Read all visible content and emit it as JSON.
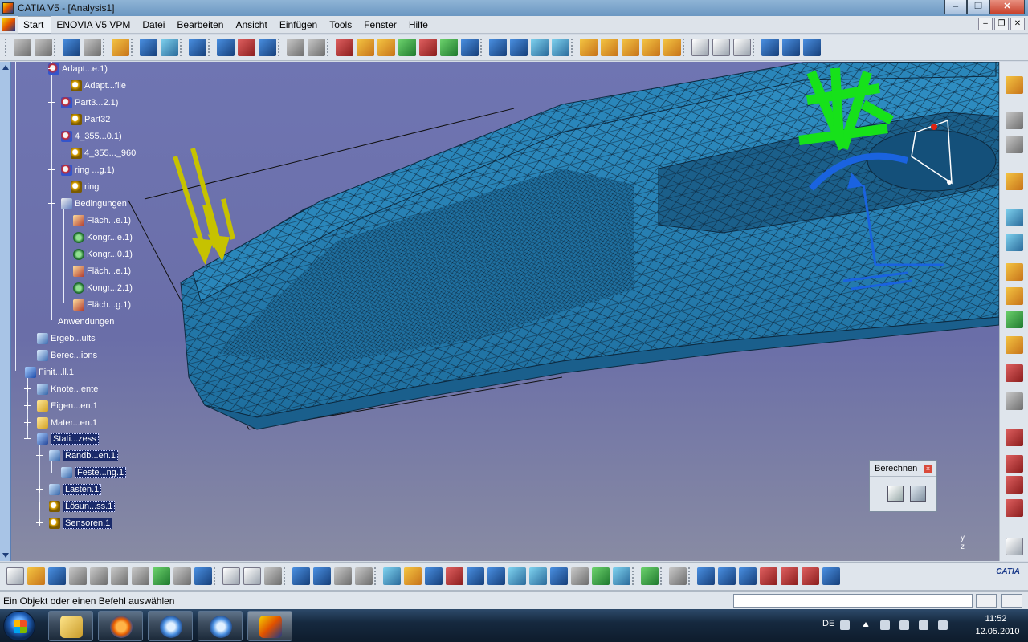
{
  "window": {
    "title": "CATIA V5 - [Analysis1]"
  },
  "menu": {
    "items": [
      {
        "label": "Start"
      },
      {
        "label": "ENOVIA V5 VPM"
      },
      {
        "label": "Datei"
      },
      {
        "label": "Bearbeiten"
      },
      {
        "label": "Ansicht"
      },
      {
        "label": "Einfügen"
      },
      {
        "label": "Tools"
      },
      {
        "label": "Fenster"
      },
      {
        "label": "Hilfe"
      }
    ]
  },
  "tree": {
    "nodes": [
      {
        "label": "Adapt...e.1)",
        "icon": "product-icon"
      },
      {
        "label": "Adapt...file",
        "icon": "part-icon"
      },
      {
        "label": "Part3...2.1)",
        "icon": "product-icon"
      },
      {
        "label": "Part32",
        "icon": "part-icon"
      },
      {
        "label": "4_355...0.1)",
        "icon": "product-icon"
      },
      {
        "label": "4_355..._960",
        "icon": "part-icon"
      },
      {
        "label": "ring ...g.1)",
        "icon": "product-icon"
      },
      {
        "label": "ring",
        "icon": "part-icon"
      },
      {
        "label": "Bedingungen",
        "icon": "constraints-icon"
      },
      {
        "label": "Fläch...e.1)",
        "icon": "surface-contact-icon"
      },
      {
        "label": "Kongr...e.1)",
        "icon": "coincidence-icon"
      },
      {
        "label": "Kongr...0.1)",
        "icon": "coincidence-icon"
      },
      {
        "label": "Fläch...e.1)",
        "icon": "surface-contact-icon"
      },
      {
        "label": "Kongr...2.1)",
        "icon": "coincidence-icon"
      },
      {
        "label": "Fläch...g.1)",
        "icon": "surface-contact-icon"
      },
      {
        "label": "Anwendungen",
        "icon": ""
      },
      {
        "label": "Ergeb...ults",
        "icon": "results-icon"
      },
      {
        "label": "Berec...ions",
        "icon": "results-icon"
      },
      {
        "label": "Finit...ll.1",
        "icon": "finite-element-icon"
      },
      {
        "label": "Knote...ente",
        "icon": "mesh-icon"
      },
      {
        "label": "Eigen...en.1",
        "icon": "folder-icon"
      },
      {
        "label": "Mater...en.1",
        "icon": "folder-icon"
      },
      {
        "label": "Stati...zess",
        "icon": "static-case-icon"
      },
      {
        "label": "Randb...en.1",
        "icon": "restraints-icon"
      },
      {
        "label": "Feste...ng.1",
        "icon": "clamp-icon"
      },
      {
        "label": "Lasten.1",
        "icon": "loads-icon"
      },
      {
        "label": "Lösun...ss.1",
        "icon": "solution-icon"
      },
      {
        "label": "Sensoren.1",
        "icon": "sensors-icon"
      }
    ]
  },
  "berechnen": {
    "title": "Berechnen"
  },
  "axis_label": "y\nz",
  "status": {
    "message": "Ein Objekt oder einen Befehl auswählen",
    "command_value": ""
  },
  "taskbar": {
    "lang": "DE",
    "time": "11:52",
    "date": "12.05.2010",
    "apps": [
      "explorer-icon",
      "firefox-icon",
      "itunes-icon",
      "itunes-icon",
      "catia-icon"
    ]
  },
  "brand": "CATIA"
}
